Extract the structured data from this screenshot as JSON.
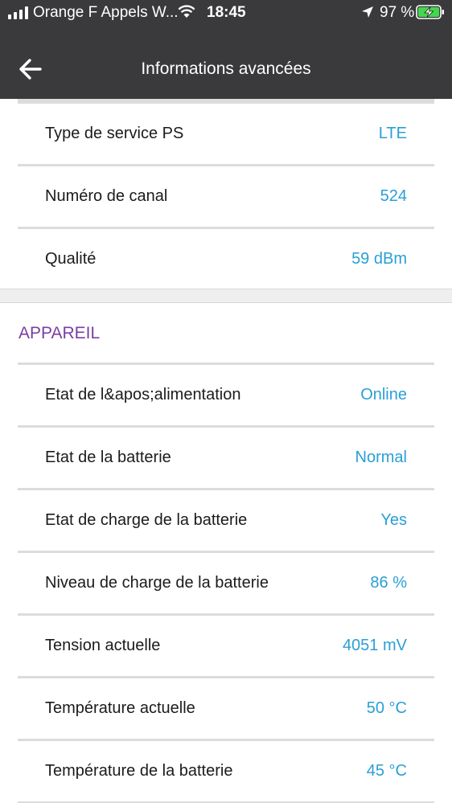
{
  "status_bar": {
    "carrier": "Orange F Appels W...",
    "time": "18:45",
    "battery_percent": "97 %"
  },
  "nav": {
    "title": "Informations avancées"
  },
  "network_rows": [
    {
      "label": "Type de service PS",
      "value": "LTE"
    },
    {
      "label": "Numéro de canal",
      "value": "524"
    },
    {
      "label": "Qualité",
      "value": "59 dBm"
    }
  ],
  "device_section": {
    "title": "APPAREIL",
    "rows": [
      {
        "label": "Etat de l&apos;alimentation",
        "value": "Online"
      },
      {
        "label": "Etat de la batterie",
        "value": "Normal"
      },
      {
        "label": "Etat de charge de la batterie",
        "value": "Yes"
      },
      {
        "label": "Niveau de charge de la batterie",
        "value": "86 %"
      },
      {
        "label": "Tension actuelle",
        "value": "4051 mV"
      },
      {
        "label": "Température actuelle",
        "value": "50 °C"
      },
      {
        "label": "Température de la batterie",
        "value": "45 °C"
      }
    ]
  },
  "colors": {
    "header_bg": "#3a3a3c",
    "value_blue": "#2a9fd6",
    "section_purple": "#7b3fa0"
  }
}
